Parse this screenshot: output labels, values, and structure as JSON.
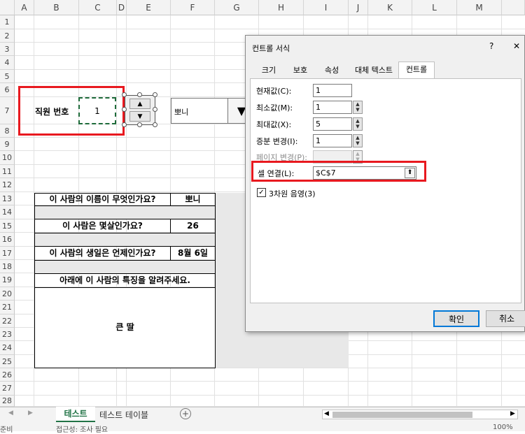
{
  "columns": [
    "A",
    "B",
    "C",
    "D",
    "E",
    "F",
    "G",
    "H",
    "I",
    "J",
    "K",
    "L",
    "M"
  ],
  "rows": [
    "1",
    "2",
    "3",
    "4",
    "5",
    "6",
    "7",
    "8",
    "9",
    "10",
    "11",
    "12",
    "13",
    "14",
    "15",
    "16",
    "17",
    "18",
    "19",
    "20",
    "21",
    "22",
    "23",
    "24",
    "25",
    "26",
    "27",
    "28"
  ],
  "sheet": {
    "employee_label": "직원 번호",
    "employee_value": "1",
    "dropdown_value": "뽀니",
    "q1": "이 사람의 이름이 무엇인가요?",
    "a1": "뽀니",
    "q2": "이 사람은 몇살인가요?",
    "a2": "26",
    "q3": "이 사람의 생일은 언제인가요?",
    "a3": "8월 6일",
    "q4": "아래에 이 사람의 특징을 알려주세요.",
    "a4": "큰 딸"
  },
  "dialog": {
    "title": "컨트롤 서식",
    "help": "?",
    "close": "✕",
    "tabs": [
      "크기",
      "보호",
      "속성",
      "대체 텍스트",
      "컨트롤"
    ],
    "active_tab": "컨트롤",
    "current_label": "현재값(C):",
    "current_value": "1",
    "min_label": "최소값(M):",
    "min_value": "1",
    "max_label": "최대값(X):",
    "max_value": "5",
    "inc_label": "증분 변경(I):",
    "inc_value": "1",
    "page_label": "페이지 변경(P):",
    "link_label": "셀 연결(L):",
    "link_value": "$C$7",
    "shade_label": "3차원 음영(3)",
    "ok": "확인",
    "cancel": "취소"
  },
  "tabs_bar": {
    "sheet1": "테스트",
    "sheet2": "테스트 테이블",
    "add": "+"
  },
  "status": {
    "left": "준비",
    "accessibility": "접근성: 조사 필요",
    "zoom": "100%"
  },
  "colors": {
    "highlight": "#e8191f",
    "active_tab": "#217346"
  }
}
